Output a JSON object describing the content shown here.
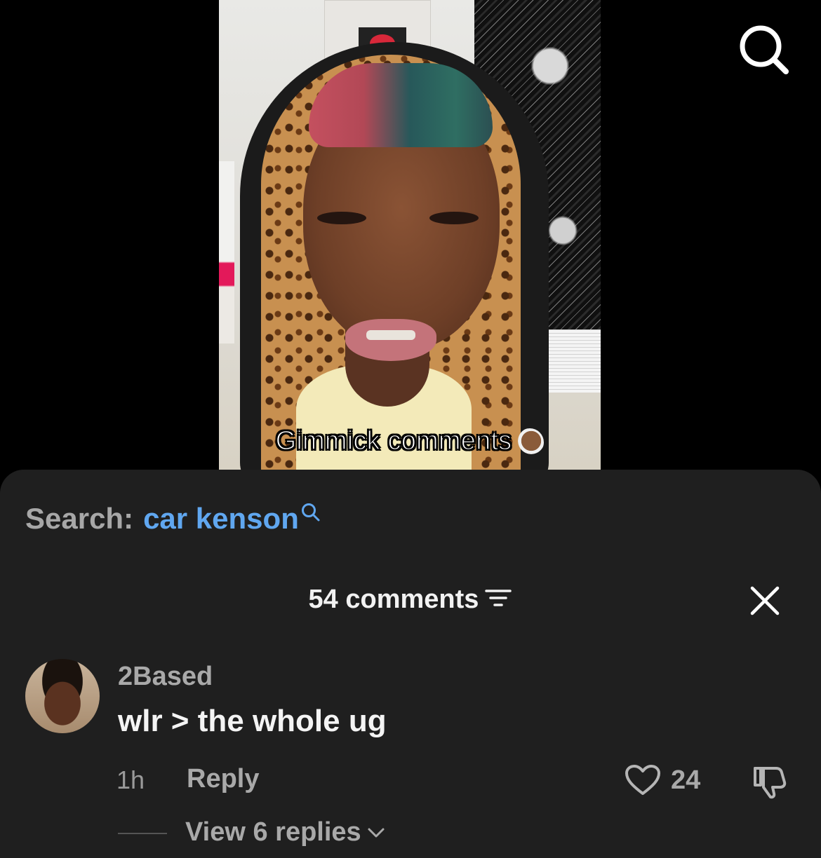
{
  "video": {
    "caption": "Gimmick comments",
    "caption_emoji": "face-palm-emoji"
  },
  "top_bar": {
    "search_icon": "search-icon"
  },
  "sheet": {
    "search_label": "Search:",
    "search_query": "car kenson",
    "search_query_color": "#60a7f0",
    "comments_count_label": "54 comments",
    "sort_icon": "filter-lines-icon",
    "close_icon": "close-icon"
  },
  "comment": {
    "username": "2Based",
    "text": "wlr > the whole ug",
    "time": "1h",
    "reply_label": "Reply",
    "like_count": "24",
    "view_replies_label": "View 6 replies"
  },
  "colors": {
    "background": "#000000",
    "sheet": "#1f1f1f",
    "primary_text": "#f4f4f4",
    "secondary_text": "#a9a9a9"
  }
}
